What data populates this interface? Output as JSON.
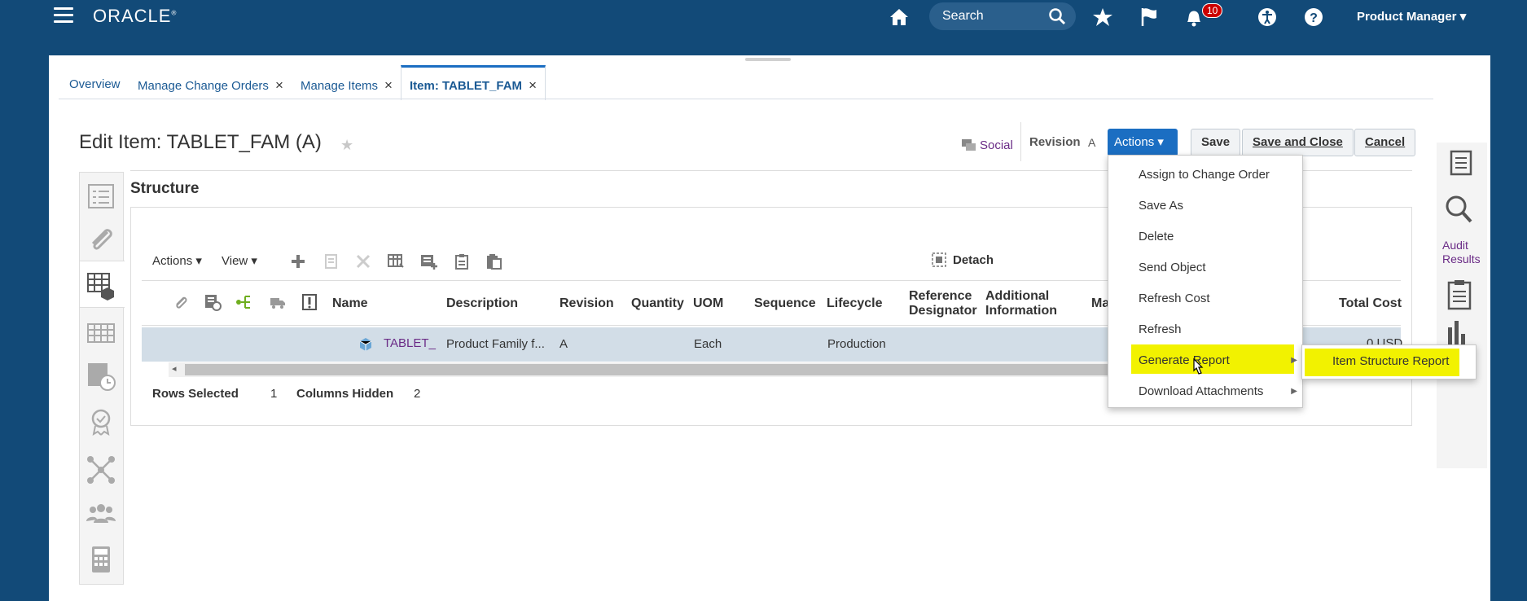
{
  "header": {
    "logo": "ORACLE",
    "search_placeholder": "Search",
    "notification_count": "10",
    "user_menu": "Product Manager"
  },
  "tabs": [
    {
      "label": "Overview",
      "closable": false
    },
    {
      "label": "Manage Change Orders",
      "closable": true
    },
    {
      "label": "Manage Items",
      "closable": true
    },
    {
      "label": "Item: TABLET_FAM",
      "closable": true,
      "active": true
    }
  ],
  "page": {
    "title": "Edit Item: TABLET_FAM (A)",
    "social_label": "Social",
    "revision_label": "Revision",
    "revision_value": "A",
    "actions_label": "Actions",
    "save_label": "Save",
    "save_close_label": "Save and Close",
    "cancel_label": "Cancel"
  },
  "structure": {
    "heading": "Structure",
    "toolbar": {
      "actions": "Actions",
      "view": "View",
      "detach": "Detach"
    },
    "columns": [
      "Name",
      "Description",
      "Revision",
      "Quantity",
      "UOM",
      "Sequence",
      "Lifecycle",
      "Reference Designator",
      "Additional Information",
      "Ma",
      "Total Cost"
    ],
    "row": {
      "name": "TABLET_",
      "description": "Product Family f...",
      "revision": "A",
      "uom": "Each",
      "lifecycle": "Production",
      "total_cost": "0 USD"
    },
    "footer": {
      "rows_selected_label": "Rows Selected",
      "rows_selected_value": "1",
      "columns_hidden_label": "Columns Hidden",
      "columns_hidden_value": "2"
    }
  },
  "actions_menu": {
    "items": [
      {
        "label": "Assign to Change Order"
      },
      {
        "label": "Save As"
      },
      {
        "label": "Delete"
      },
      {
        "label": "Send Object"
      },
      {
        "label": "Refresh Cost"
      },
      {
        "label": "Refresh"
      },
      {
        "label": "Generate Report",
        "submenu": true,
        "highlighted": true
      },
      {
        "label": "Download Attachments",
        "submenu": true
      }
    ],
    "submenu_items": [
      {
        "label": "Item Structure Report",
        "highlighted": true
      }
    ]
  },
  "side_panel": {
    "audit_results": "Audit Results"
  },
  "colors": {
    "banner": "#124a78",
    "accent": "#1b6ec2",
    "highlight": "#f2f200",
    "link_purple": "#6a2b86"
  }
}
